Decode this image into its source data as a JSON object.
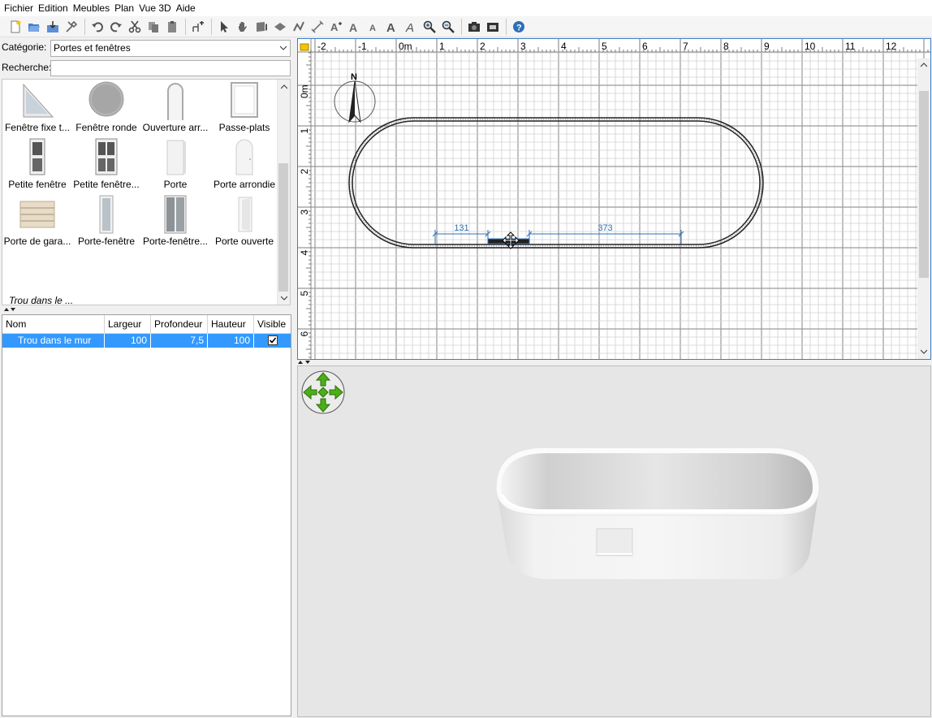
{
  "menu": [
    "Fichier",
    "Edition",
    "Meubles",
    "Plan",
    "Vue 3D",
    "Aide"
  ],
  "toolbar": {
    "icons": [
      "new-icon",
      "open-icon",
      "save-icon",
      "preferences-icon",
      "undo-icon",
      "redo-icon",
      "cut-icon",
      "copy-icon",
      "paste-icon",
      "add-furniture-icon",
      "select-icon",
      "pan-icon",
      "create-walls-icon",
      "create-rooms-icon",
      "create-polylines-icon",
      "create-dimensions-icon",
      "add-text-icon",
      "text-style-icon",
      "bold-icon",
      "italic-icon",
      "zoom-in-icon",
      "zoom-out-icon",
      "photo-icon",
      "video-icon",
      "help-icon"
    ]
  },
  "catalog": {
    "category_label": "Catégorie:",
    "category_value": "Portes et fenêtres",
    "search_label": "Recherche:",
    "search_value": "",
    "items": [
      {
        "label": "Fenêtre fixe t..."
      },
      {
        "label": "Fenêtre ronde"
      },
      {
        "label": "Ouverture arr..."
      },
      {
        "label": "Passe-plats"
      },
      {
        "label": "Petite fenêtre"
      },
      {
        "label": "Petite fenêtre..."
      },
      {
        "label": "Porte"
      },
      {
        "label": "Porte arrondie"
      },
      {
        "label": "Porte de gara..."
      },
      {
        "label": "Porte-fenêtre"
      },
      {
        "label": "Porte-fenêtre..."
      },
      {
        "label": "Porte ouverte"
      }
    ],
    "partial_label": "Trou dans le ..."
  },
  "furniture_table": {
    "columns": [
      "Nom",
      "Largeur",
      "Profondeur",
      "Hauteur",
      "Visible"
    ],
    "rows": [
      {
        "name": "Trou dans le mur",
        "width": "100",
        "depth": "7,5",
        "height": "100",
        "visible": true
      }
    ]
  },
  "plan": {
    "ruler_x": [
      "-2",
      "-1",
      "0m",
      "1",
      "2",
      "3",
      "4",
      "5",
      "6",
      "7",
      "8",
      "9",
      "10",
      "11",
      "12"
    ],
    "ruler_y": [
      "0m",
      "1",
      "2",
      "3",
      "4",
      "5",
      "6"
    ],
    "compass": "N",
    "dimensions": [
      "131",
      "373"
    ]
  },
  "colors": {
    "selection": "#3399ff",
    "plan_border": "#3c7fc3",
    "dimension": "#2d6fb5",
    "nav_green": "#4caf1a"
  }
}
